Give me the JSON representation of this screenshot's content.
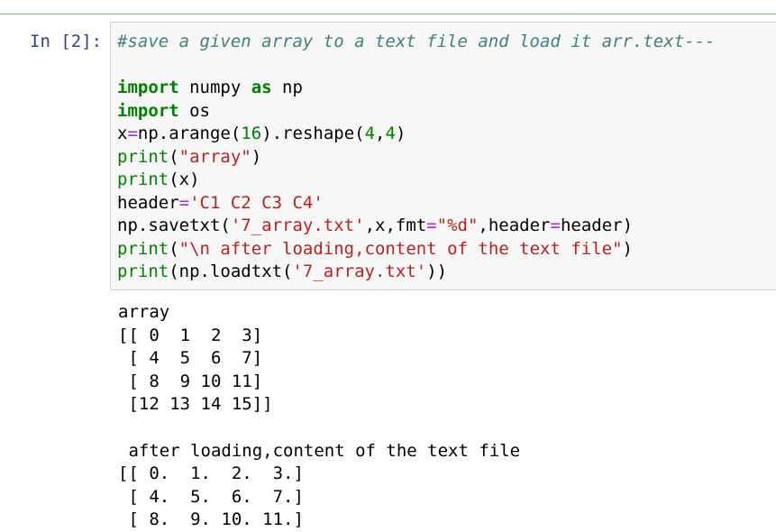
{
  "cell": {
    "prompt": "In [2]:",
    "code_lines": [
      [
        {
          "t": "#save a given array to a text file and load it arr.text---",
          "c": "cm"
        }
      ],
      [
        {
          "t": "",
          "c": ""
        }
      ],
      [
        {
          "t": "import",
          "c": "kw"
        },
        {
          "t": " numpy ",
          "c": ""
        },
        {
          "t": "as",
          "c": "kw"
        },
        {
          "t": " np",
          "c": ""
        }
      ],
      [
        {
          "t": "import",
          "c": "kw"
        },
        {
          "t": " os",
          "c": ""
        }
      ],
      [
        {
          "t": "x",
          "c": ""
        },
        {
          "t": "=",
          "c": "op"
        },
        {
          "t": "np.arange(",
          "c": ""
        },
        {
          "t": "16",
          "c": "num"
        },
        {
          "t": ").reshape(",
          "c": ""
        },
        {
          "t": "4",
          "c": "num"
        },
        {
          "t": ",",
          "c": ""
        },
        {
          "t": "4",
          "c": "num"
        },
        {
          "t": ")",
          "c": ""
        }
      ],
      [
        {
          "t": "print",
          "c": "bi"
        },
        {
          "t": "(",
          "c": ""
        },
        {
          "t": "\"array\"",
          "c": "str"
        },
        {
          "t": ")",
          "c": ""
        }
      ],
      [
        {
          "t": "print",
          "c": "bi"
        },
        {
          "t": "(x)",
          "c": ""
        }
      ],
      [
        {
          "t": "header",
          "c": ""
        },
        {
          "t": "=",
          "c": "op"
        },
        {
          "t": "'C1 C2 C3 C4'",
          "c": "str"
        }
      ],
      [
        {
          "t": "np.savetxt(",
          "c": ""
        },
        {
          "t": "'7_array.txt'",
          "c": "str"
        },
        {
          "t": ",x,fmt",
          "c": ""
        },
        {
          "t": "=",
          "c": "op"
        },
        {
          "t": "\"%d\"",
          "c": "str"
        },
        {
          "t": ",header",
          "c": ""
        },
        {
          "t": "=",
          "c": "op"
        },
        {
          "t": "header)",
          "c": ""
        }
      ],
      [
        {
          "t": "print",
          "c": "bi"
        },
        {
          "t": "(",
          "c": ""
        },
        {
          "t": "\"\\n after loading,content of the text file\"",
          "c": "str"
        },
        {
          "t": ")",
          "c": ""
        }
      ],
      [
        {
          "t": "print",
          "c": "bi"
        },
        {
          "t": "(np.loadtxt(",
          "c": ""
        },
        {
          "t": "'7_array.txt'",
          "c": "str"
        },
        {
          "t": "))",
          "c": ""
        }
      ]
    ],
    "output_lines": [
      "array",
      "[[ 0  1  2  3]",
      " [ 4  5  6  7]",
      " [ 8  9 10 11]",
      " [12 13 14 15]]",
      "",
      " after loading,content of the text file",
      "[[ 0.  1.  2.  3.]",
      " [ 4.  5.  6.  7.]",
      " [ 8.  9. 10. 11.]"
    ]
  }
}
